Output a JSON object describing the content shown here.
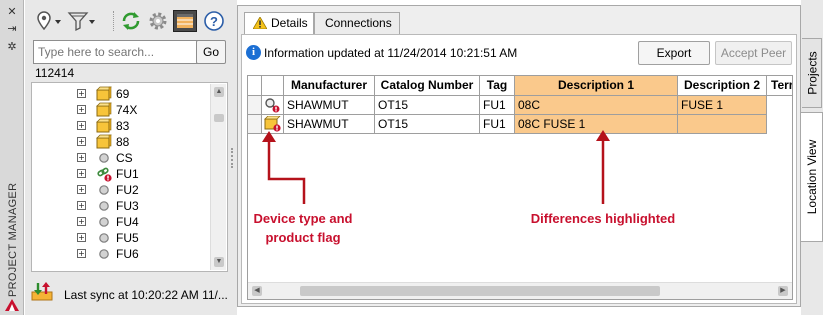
{
  "palette": {
    "panel_title": "PROJECT MANAGER",
    "toolbar_icons": [
      "location-filter-icon",
      "filter-icon",
      "refresh-icon",
      "settings-icon",
      "details-view-icon",
      "help-icon"
    ],
    "search": {
      "placeholder": "Type here to search...",
      "go_label": "Go"
    },
    "project_id": "112414",
    "tree_items": [
      {
        "label": "69",
        "icon": "folder-icon"
      },
      {
        "label": "74X",
        "icon": "folder-icon"
      },
      {
        "label": "83",
        "icon": "folder-icon"
      },
      {
        "label": "88",
        "icon": "folder-icon"
      },
      {
        "label": "CS",
        "icon": "component-dot-icon"
      },
      {
        "label": "FU1",
        "icon": "linked-warning-icon"
      },
      {
        "label": "FU2",
        "icon": "component-dot-icon"
      },
      {
        "label": "FU3",
        "icon": "component-dot-icon"
      },
      {
        "label": "FU4",
        "icon": "component-dot-icon"
      },
      {
        "label": "FU5",
        "icon": "component-dot-icon"
      },
      {
        "label": "FU6",
        "icon": "component-dot-icon"
      }
    ],
    "sync_text": "Last sync at 10:20:22 AM 11/..."
  },
  "details": {
    "tabs": [
      "Details",
      "Connections"
    ],
    "info_text": "Information updated at  11/24/2014 10:21:51 AM",
    "buttons": {
      "export": "Export",
      "accept_peer": "Accept Peer"
    },
    "columns": [
      "Manufacturer",
      "Catalog Number",
      "Tag",
      "Description 1",
      "Description 2",
      "Terr"
    ],
    "rows": [
      {
        "icon": "search-warning-icon",
        "cells": [
          "SHAWMUT",
          "OT15",
          "FU1",
          "08C",
          "FUSE 1"
        ]
      },
      {
        "icon": "device-warning-icon",
        "cells": [
          "SHAWMUT",
          "OT15",
          "FU1",
          "08C FUSE 1",
          ""
        ]
      }
    ],
    "highlight_color": "#fac98c"
  },
  "annotations": {
    "left": "Device type and product flag",
    "right": "Differences highlighted",
    "color": "#c8102e"
  },
  "side_tabs": [
    "Projects",
    "Location View"
  ]
}
